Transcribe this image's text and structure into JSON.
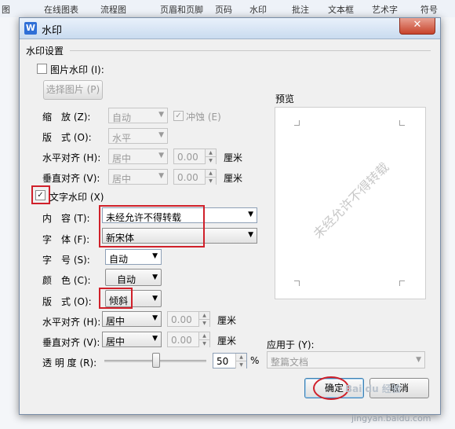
{
  "background": {
    "ribbon_items": [
      "图",
      "在线图表",
      "流程图",
      "页眉和页脚",
      "页码",
      "水印",
      "批注",
      "文本框",
      "艺术字",
      "符号"
    ]
  },
  "dialog": {
    "title": "水印",
    "app_icon": "W",
    "close_glyph": "✕",
    "group_title": "水印设置",
    "picture_watermark": {
      "label": "图片水印 (I):",
      "checked": false,
      "select_button": "选择图片 (P)",
      "scale_label": "缩　放 (Z):",
      "scale_value": "自动",
      "washout_label": "冲蚀 (E)",
      "layout_label": "版　式 (O):",
      "layout_value": "水平",
      "h_align_label": "水平对齐 (H):",
      "h_align_value": "居中",
      "h_offset": "0.00",
      "v_align_label": "垂直对齐 (V):",
      "v_align_value": "居中",
      "v_offset": "0.00",
      "unit": "厘米"
    },
    "text_watermark": {
      "label": "文字水印 (X)",
      "checked": true,
      "content_label": "内　容 (T):",
      "content_value": "未经允许不得转载",
      "font_label": "字　体 (F):",
      "font_value": "新宋体",
      "size_label": "字　号 (S):",
      "size_value": "自动",
      "color_label": "颜　色 (C):",
      "color_value": "自动",
      "layout_label": "版　式 (O):",
      "layout_value": "倾斜",
      "h_align_label": "水平对齐 (H):",
      "h_align_value": "居中",
      "h_offset": "0.00",
      "v_align_label": "垂直对齐 (V):",
      "v_align_value": "居中",
      "v_offset": "0.00",
      "unit": "厘米",
      "transparency_label": "透 明 度 (R):",
      "transparency_value": "50",
      "transparency_unit": "%",
      "transparency_fraction": 0.5
    },
    "preview": {
      "label": "预览",
      "watermark_text": "未经允许不得转载"
    },
    "apply_to": {
      "label": "应用于 (Y):",
      "value": "整篇文档"
    },
    "ok_button": "确定",
    "cancel_button": "取消"
  },
  "annotation_color": "#d0202a",
  "site_watermark": {
    "logo": "Bai du 经验",
    "url": "jingyan.baidu.com"
  }
}
